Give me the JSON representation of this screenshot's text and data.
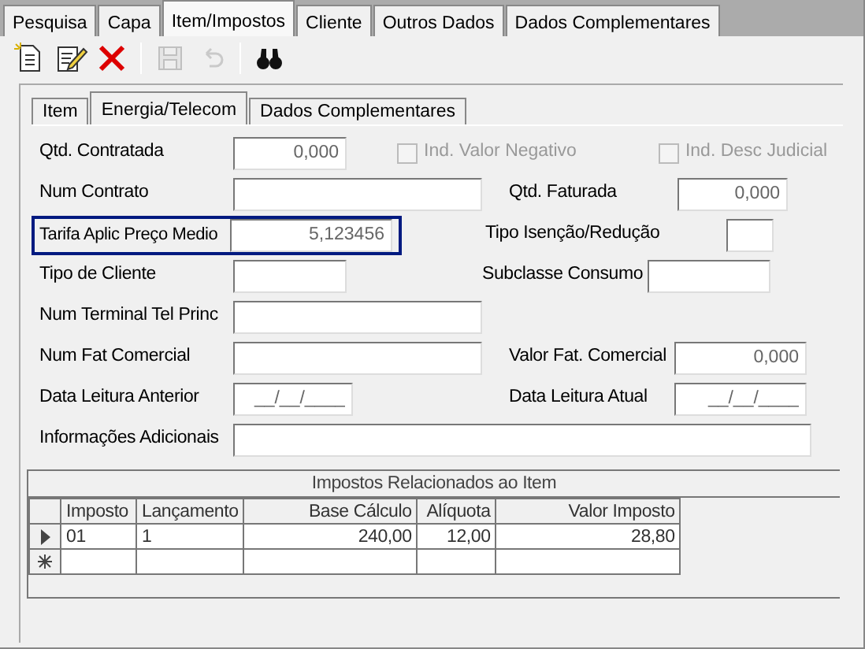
{
  "tabs": [
    {
      "label": "Pesquisa",
      "selected": false
    },
    {
      "label": "Capa",
      "selected": false
    },
    {
      "label": "Item/Impostos",
      "selected": true
    },
    {
      "label": "Cliente",
      "selected": false
    },
    {
      "label": "Outros Dados",
      "selected": false
    },
    {
      "label": "Dados Complementares",
      "selected": false
    }
  ],
  "toolbar": [
    {
      "kind": "new",
      "disabled": false
    },
    {
      "kind": "edit",
      "disabled": false
    },
    {
      "kind": "delete",
      "disabled": false
    },
    {
      "kind": "separator"
    },
    {
      "kind": "save",
      "disabled": true
    },
    {
      "kind": "undo",
      "disabled": true
    },
    {
      "kind": "separator"
    },
    {
      "kind": "find",
      "disabled": false
    }
  ],
  "inner_tabs": [
    {
      "label": "Item",
      "selected": false
    },
    {
      "label": "Energia/Telecom",
      "selected": true
    },
    {
      "label": "Dados Complementares",
      "selected": false
    }
  ],
  "form_rows": [
    {
      "items": [
        {
          "kind": "input",
          "label": "Qtd. Contratada",
          "value": "0,000",
          "focused": false
        },
        {
          "kind": "checkbox",
          "label": "Ind. Valor Negativo",
          "checked": false,
          "disabled": true
        },
        {
          "kind": "checkbox",
          "label": "Ind. Desc Judicial",
          "checked": false,
          "disabled": true
        }
      ]
    },
    {
      "items": [
        {
          "kind": "input",
          "label": "Num Contrato",
          "focused": false
        },
        {
          "kind": "input",
          "label": "Qtd. Faturada",
          "value": "0,000",
          "focused": false
        }
      ]
    },
    {
      "items": [
        {
          "kind": "input",
          "label": "Tarifa Aplic Preço Medio",
          "value": "5,123456",
          "focused": true
        },
        {
          "kind": "input",
          "label": "Tipo Isenção/Redução",
          "focused": false
        }
      ]
    },
    {
      "items": [
        {
          "kind": "input",
          "label": "Tipo de Cliente",
          "focused": false
        },
        {
          "kind": "input",
          "label": "Subclasse Consumo",
          "focused": false
        }
      ]
    },
    {
      "items": [
        {
          "kind": "input",
          "label": "Num Terminal Tel Princ",
          "focused": false
        }
      ]
    },
    {
      "items": [
        {
          "kind": "input",
          "label": "Num Fat Comercial",
          "focused": false
        },
        {
          "kind": "input",
          "label": "Valor Fat. Comercial",
          "value": "0,000",
          "focused": false
        }
      ]
    },
    {
      "items": [
        {
          "kind": "input",
          "label": "Data Leitura Anterior",
          "value": "__/__/____",
          "focused": false
        },
        {
          "kind": "input",
          "label": "Data Leitura Atual",
          "value": "__/__/____",
          "focused": false
        }
      ]
    },
    {
      "items": [
        {
          "kind": "input",
          "label": "Informações Adicionais",
          "focused": false
        }
      ]
    }
  ],
  "grid": {
    "title": "Impostos Relacionados ao Item",
    "columns": [
      "Imposto",
      "Lançamento",
      "Base Cálculo",
      "Alíquota",
      "Valor Imposto"
    ],
    "rows": [
      {
        "kind": "current",
        "cells": [
          "01",
          "1",
          "240,00",
          "12,00",
          "28,80"
        ]
      },
      {
        "kind": "new",
        "cells": []
      }
    ]
  }
}
